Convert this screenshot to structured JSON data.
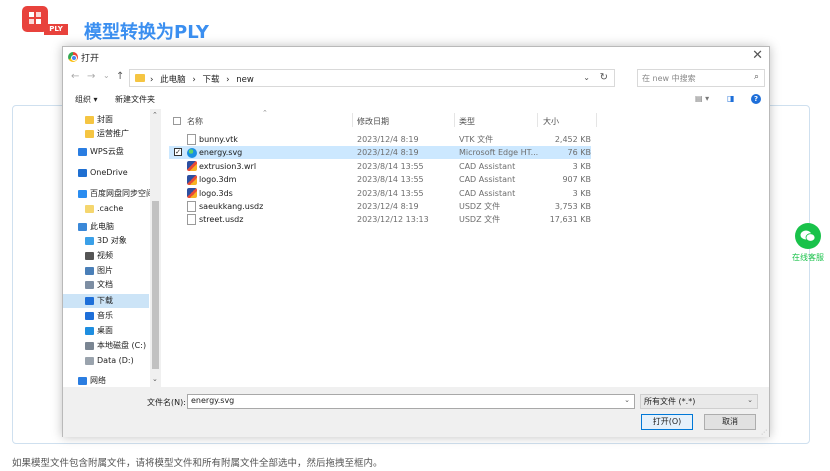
{
  "page": {
    "badge": "PLY",
    "title": "模型转换为PLY",
    "hint": "如果模型文件包含附属文件，请将模型文件和所有附属文件全部选中，然后拖拽至框内。",
    "wechat_label": "在线客服"
  },
  "dialog": {
    "title": "打开",
    "close": "✕",
    "nav": {
      "back": "←",
      "forward": "→",
      "history": "⌄",
      "up": "↑"
    },
    "breadcrumbs": [
      "›",
      "此电脑",
      "›",
      "下载",
      "›",
      "new"
    ],
    "search_placeholder": "在 new 中搜索",
    "toolbar": {
      "organize": "组织 ▾",
      "new_folder": "新建文件夹",
      "view": "▤ ▾",
      "pane": "◨"
    },
    "nav_items": [
      {
        "label": "封面",
        "icon": "folder-icon",
        "color": "#f5c542",
        "indent": 1
      },
      {
        "label": "运营推广",
        "icon": "folder-icon",
        "color": "#f5c542",
        "indent": 1
      },
      {
        "label": "WPS云盘",
        "icon": "cloud-icon",
        "color": "#2a7de1",
        "indent": 0
      },
      {
        "label": "OneDrive",
        "icon": "cloud-icon",
        "color": "#1f6fd1",
        "indent": 0
      },
      {
        "label": "百度网盘同步空间",
        "icon": "baidu-icon",
        "color": "#2a8cf0",
        "indent": 0
      },
      {
        "label": ".cache",
        "icon": "folder-icon",
        "color": "#f5d66e",
        "indent": 1
      },
      {
        "label": "此电脑",
        "icon": "computer-icon",
        "color": "#3a88d8",
        "indent": 0
      },
      {
        "label": "3D 对象",
        "icon": "cube-icon",
        "color": "#3aa0e8",
        "indent": 1
      },
      {
        "label": "视频",
        "icon": "video-icon",
        "color": "#555555",
        "indent": 1
      },
      {
        "label": "图片",
        "icon": "image-icon",
        "color": "#4a7fb8",
        "indent": 1
      },
      {
        "label": "文档",
        "icon": "document-icon",
        "color": "#7d8ea3",
        "indent": 1
      },
      {
        "label": "下载",
        "icon": "download-icon",
        "color": "#1e6fd9",
        "indent": 1
      },
      {
        "label": "音乐",
        "icon": "music-icon",
        "color": "#1e6fd9",
        "indent": 1
      },
      {
        "label": "桌面",
        "icon": "desktop-icon",
        "color": "#1e8ee0",
        "indent": 1
      },
      {
        "label": "本地磁盘 (C:)",
        "icon": "drive-icon",
        "color": "#7a8592",
        "indent": 1
      },
      {
        "label": "Data (D:)",
        "icon": "drive-icon",
        "color": "#9aa3ad",
        "indent": 1
      },
      {
        "label": "网络",
        "icon": "network-icon",
        "color": "#2a7de1",
        "indent": 0
      }
    ],
    "selected_nav": "下载",
    "columns": {
      "name": "名称",
      "date": "修改日期",
      "type": "类型",
      "size": "大小"
    },
    "files": [
      {
        "name": "bunny.vtk",
        "date": "2023/12/4 8:19",
        "type": "VTK 文件",
        "size": "2,452 KB",
        "icon": "doc",
        "selected": false
      },
      {
        "name": "energy.svg",
        "date": "2023/12/4 8:19",
        "type": "Microsoft Edge HT...",
        "size": "76 KB",
        "icon": "edge",
        "selected": true
      },
      {
        "name": "extrusion3.wrl",
        "date": "2023/8/14 13:55",
        "type": "CAD Assistant",
        "size": "3 KB",
        "icon": "cad",
        "selected": false
      },
      {
        "name": "logo.3dm",
        "date": "2023/8/14 13:55",
        "type": "CAD Assistant",
        "size": "907 KB",
        "icon": "cad",
        "selected": false
      },
      {
        "name": "logo.3ds",
        "date": "2023/8/14 13:55",
        "type": "CAD Assistant",
        "size": "3 KB",
        "icon": "cad",
        "selected": false
      },
      {
        "name": "saeukkang.usdz",
        "date": "2023/12/4 8:19",
        "type": "USDZ 文件",
        "size": "3,753 KB",
        "icon": "doc",
        "selected": false
      },
      {
        "name": "street.usdz",
        "date": "2023/12/12 13:13",
        "type": "USDZ 文件",
        "size": "17,631 KB",
        "icon": "doc",
        "selected": false
      }
    ],
    "filename_label": "文件名(N):",
    "filename_value": "energy.svg",
    "filetype_value": "所有文件 (*.*)",
    "open_button": "打开(O)",
    "cancel_button": "取消"
  }
}
